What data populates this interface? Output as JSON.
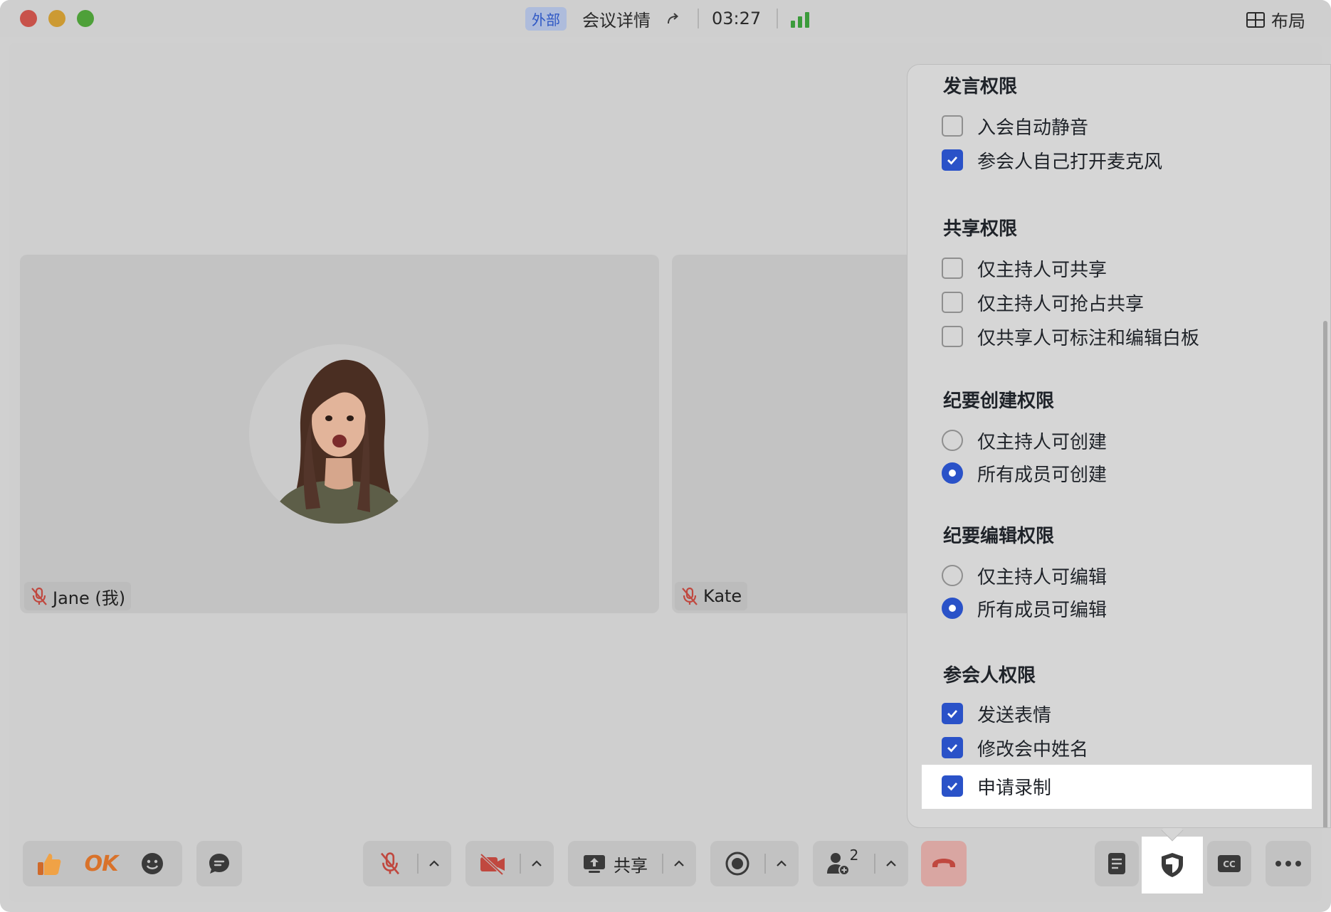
{
  "titlebar": {
    "badge": "外部",
    "meeting_title": "会议详情",
    "elapsed": "03:27",
    "layout_label": "布局"
  },
  "participants": [
    {
      "name": "Jane (我)",
      "muted": true
    },
    {
      "name": "Kate",
      "muted": true
    }
  ],
  "toolbar": {
    "reaction_ok": "OK",
    "share_label": "共享",
    "participant_count": "2"
  },
  "permissions": {
    "speak": {
      "title": "发言权限",
      "options": [
        {
          "label": "入会自动静音",
          "checked": false
        },
        {
          "label": "参会人自己打开麦克风",
          "checked": true
        }
      ]
    },
    "share": {
      "title": "共享权限",
      "options": [
        {
          "label": "仅主持人可共享",
          "checked": false
        },
        {
          "label": "仅主持人可抢占共享",
          "checked": false
        },
        {
          "label": "仅共享人可标注和编辑白板",
          "checked": false
        }
      ]
    },
    "minutes_create": {
      "title": "纪要创建权限",
      "options": [
        {
          "label": "仅主持人可创建",
          "selected": false
        },
        {
          "label": "所有成员可创建",
          "selected": true
        }
      ]
    },
    "minutes_edit": {
      "title": "纪要编辑权限",
      "options": [
        {
          "label": "仅主持人可编辑",
          "selected": false
        },
        {
          "label": "所有成员可编辑",
          "selected": true
        }
      ]
    },
    "attendee": {
      "title": "参会人权限",
      "options": [
        {
          "label": "发送表情",
          "checked": true
        },
        {
          "label": "修改会中姓名",
          "checked": true
        },
        {
          "label": "申请录制",
          "checked": true
        }
      ]
    }
  },
  "colors": {
    "accent": "#2a52c8",
    "signal": "#3b9b3b",
    "hangup": "#d9a6a2",
    "mute_red": "#c0483f"
  }
}
